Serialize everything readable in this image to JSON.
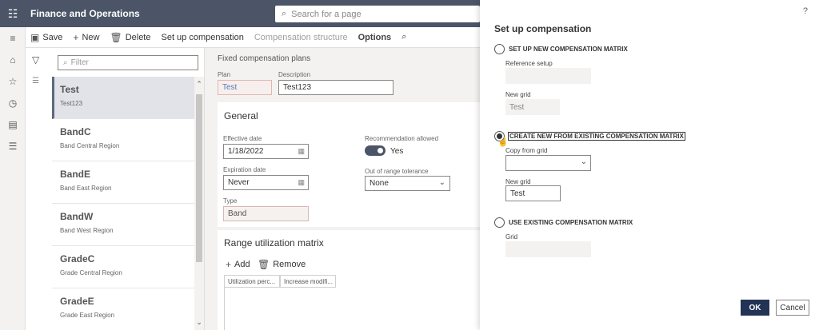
{
  "app": {
    "title": "Finance and Operations",
    "search_placeholder": "Search for a page"
  },
  "toolbar": {
    "save": "Save",
    "new": "New",
    "delete": "Delete",
    "setup_compensation": "Set up compensation",
    "compensation_structure": "Compensation structure",
    "options": "Options"
  },
  "list": {
    "filter_placeholder": "Filter",
    "items": [
      {
        "name": "Test",
        "desc": "Test123"
      },
      {
        "name": "BandC",
        "desc": "Band Central Region"
      },
      {
        "name": "BandE",
        "desc": "Band East Region"
      },
      {
        "name": "BandW",
        "desc": "Band West Region"
      },
      {
        "name": "GradeC",
        "desc": "Grade Central Region"
      },
      {
        "name": "GradeE",
        "desc": "Grade East Region"
      }
    ]
  },
  "details": {
    "header": "Fixed compensation plans",
    "plan_label": "Plan",
    "plan_value": "Test",
    "description_label": "Description",
    "description_value": "Test123",
    "general_title": "General",
    "effective_date_label": "Effective date",
    "effective_date_value": "1/18/2022",
    "recommendation_label": "Recommendation allowed",
    "recommendation_value": "Yes",
    "expiration_date_label": "Expiration date",
    "expiration_date_value": "Never",
    "out_of_range_label": "Out of range tolerance",
    "out_of_range_value": "None",
    "type_label": "Type",
    "type_value": "Band",
    "range_title": "Range utilization matrix",
    "add": "Add",
    "remove": "Remove",
    "col1": "Utilization perc...",
    "col2": "Increase modifi..."
  },
  "dialog": {
    "help": "?",
    "title": "Set up compensation",
    "opt1": "SET UP NEW COMPENSATION MATRIX",
    "ref_setup_label": "Reference setup",
    "new_grid_label1": "New grid",
    "new_grid_value1": "Test",
    "opt2": "CREATE NEW FROM EXISTING COMPENSATION MATRIX",
    "copy_from_label": "Copy from grid",
    "new_grid_label2": "New grid",
    "new_grid_value2": "Test",
    "opt3": "USE EXISTING COMPENSATION MATRIX",
    "grid_label": "Grid",
    "ok": "OK",
    "cancel": "Cancel"
  }
}
